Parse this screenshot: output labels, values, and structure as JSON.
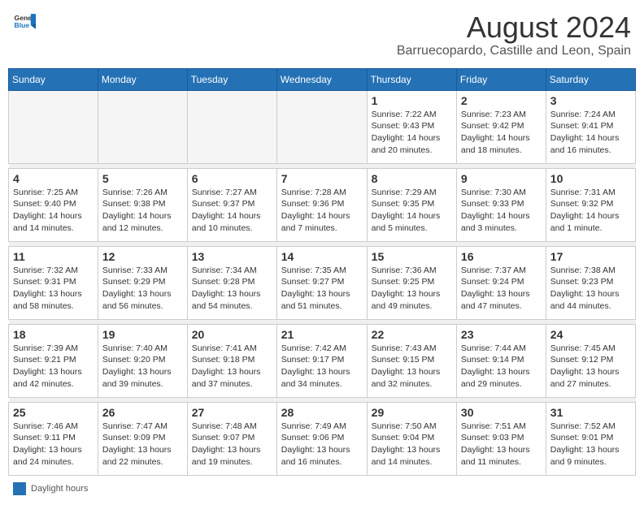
{
  "header": {
    "logo_general": "General",
    "logo_blue": "Blue",
    "main_title": "August 2024",
    "subtitle": "Barruecopardo, Castille and Leon, Spain"
  },
  "calendar": {
    "days_of_week": [
      "Sunday",
      "Monday",
      "Tuesday",
      "Wednesday",
      "Thursday",
      "Friday",
      "Saturday"
    ],
    "weeks": [
      [
        {
          "day": "",
          "info": ""
        },
        {
          "day": "",
          "info": ""
        },
        {
          "day": "",
          "info": ""
        },
        {
          "day": "",
          "info": ""
        },
        {
          "day": "1",
          "info": "Sunrise: 7:22 AM\nSunset: 9:43 PM\nDaylight: 14 hours\nand 20 minutes."
        },
        {
          "day": "2",
          "info": "Sunrise: 7:23 AM\nSunset: 9:42 PM\nDaylight: 14 hours\nand 18 minutes."
        },
        {
          "day": "3",
          "info": "Sunrise: 7:24 AM\nSunset: 9:41 PM\nDaylight: 14 hours\nand 16 minutes."
        }
      ],
      [
        {
          "day": "4",
          "info": "Sunrise: 7:25 AM\nSunset: 9:40 PM\nDaylight: 14 hours\nand 14 minutes."
        },
        {
          "day": "5",
          "info": "Sunrise: 7:26 AM\nSunset: 9:38 PM\nDaylight: 14 hours\nand 12 minutes."
        },
        {
          "day": "6",
          "info": "Sunrise: 7:27 AM\nSunset: 9:37 PM\nDaylight: 14 hours\nand 10 minutes."
        },
        {
          "day": "7",
          "info": "Sunrise: 7:28 AM\nSunset: 9:36 PM\nDaylight: 14 hours\nand 7 minutes."
        },
        {
          "day": "8",
          "info": "Sunrise: 7:29 AM\nSunset: 9:35 PM\nDaylight: 14 hours\nand 5 minutes."
        },
        {
          "day": "9",
          "info": "Sunrise: 7:30 AM\nSunset: 9:33 PM\nDaylight: 14 hours\nand 3 minutes."
        },
        {
          "day": "10",
          "info": "Sunrise: 7:31 AM\nSunset: 9:32 PM\nDaylight: 14 hours\nand 1 minute."
        }
      ],
      [
        {
          "day": "11",
          "info": "Sunrise: 7:32 AM\nSunset: 9:31 PM\nDaylight: 13 hours\nand 58 minutes."
        },
        {
          "day": "12",
          "info": "Sunrise: 7:33 AM\nSunset: 9:29 PM\nDaylight: 13 hours\nand 56 minutes."
        },
        {
          "day": "13",
          "info": "Sunrise: 7:34 AM\nSunset: 9:28 PM\nDaylight: 13 hours\nand 54 minutes."
        },
        {
          "day": "14",
          "info": "Sunrise: 7:35 AM\nSunset: 9:27 PM\nDaylight: 13 hours\nand 51 minutes."
        },
        {
          "day": "15",
          "info": "Sunrise: 7:36 AM\nSunset: 9:25 PM\nDaylight: 13 hours\nand 49 minutes."
        },
        {
          "day": "16",
          "info": "Sunrise: 7:37 AM\nSunset: 9:24 PM\nDaylight: 13 hours\nand 47 minutes."
        },
        {
          "day": "17",
          "info": "Sunrise: 7:38 AM\nSunset: 9:23 PM\nDaylight: 13 hours\nand 44 minutes."
        }
      ],
      [
        {
          "day": "18",
          "info": "Sunrise: 7:39 AM\nSunset: 9:21 PM\nDaylight: 13 hours\nand 42 minutes."
        },
        {
          "day": "19",
          "info": "Sunrise: 7:40 AM\nSunset: 9:20 PM\nDaylight: 13 hours\nand 39 minutes."
        },
        {
          "day": "20",
          "info": "Sunrise: 7:41 AM\nSunset: 9:18 PM\nDaylight: 13 hours\nand 37 minutes."
        },
        {
          "day": "21",
          "info": "Sunrise: 7:42 AM\nSunset: 9:17 PM\nDaylight: 13 hours\nand 34 minutes."
        },
        {
          "day": "22",
          "info": "Sunrise: 7:43 AM\nSunset: 9:15 PM\nDaylight: 13 hours\nand 32 minutes."
        },
        {
          "day": "23",
          "info": "Sunrise: 7:44 AM\nSunset: 9:14 PM\nDaylight: 13 hours\nand 29 minutes."
        },
        {
          "day": "24",
          "info": "Sunrise: 7:45 AM\nSunset: 9:12 PM\nDaylight: 13 hours\nand 27 minutes."
        }
      ],
      [
        {
          "day": "25",
          "info": "Sunrise: 7:46 AM\nSunset: 9:11 PM\nDaylight: 13 hours\nand 24 minutes."
        },
        {
          "day": "26",
          "info": "Sunrise: 7:47 AM\nSunset: 9:09 PM\nDaylight: 13 hours\nand 22 minutes."
        },
        {
          "day": "27",
          "info": "Sunrise: 7:48 AM\nSunset: 9:07 PM\nDaylight: 13 hours\nand 19 minutes."
        },
        {
          "day": "28",
          "info": "Sunrise: 7:49 AM\nSunset: 9:06 PM\nDaylight: 13 hours\nand 16 minutes."
        },
        {
          "day": "29",
          "info": "Sunrise: 7:50 AM\nSunset: 9:04 PM\nDaylight: 13 hours\nand 14 minutes."
        },
        {
          "day": "30",
          "info": "Sunrise: 7:51 AM\nSunset: 9:03 PM\nDaylight: 13 hours\nand 11 minutes."
        },
        {
          "day": "31",
          "info": "Sunrise: 7:52 AM\nSunset: 9:01 PM\nDaylight: 13 hours\nand 9 minutes."
        }
      ]
    ]
  },
  "footer": {
    "daylight_label": "Daylight hours"
  }
}
